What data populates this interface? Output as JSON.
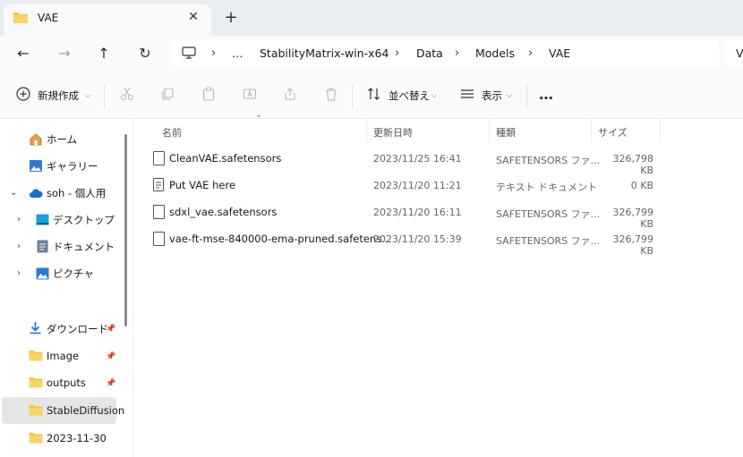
{
  "tab": {
    "title": "VAE",
    "close": "✕",
    "new_tab": "+"
  },
  "nav": {
    "back": "←",
    "forward": "→",
    "up": "↑",
    "refresh": "↻",
    "more": "…"
  },
  "breadcrumb": [
    "StabilityMatrix-win-x64",
    "Data",
    "Models",
    "VAE"
  ],
  "breadcrumb_sep": "›",
  "search_partial": "V",
  "toolbar": {
    "new_label": "新規作成",
    "sort_label": "並べ替え",
    "view_label": "表示",
    "more_label": "…"
  },
  "sidebar": {
    "items": [
      {
        "label": "ホーム",
        "icon": "home-icon"
      },
      {
        "label": "ギャラリー",
        "icon": "gallery-icon"
      },
      {
        "label": "soh - 個人用",
        "icon": "cloud-icon"
      },
      {
        "label": "デスクトップ",
        "icon": "desktop-icon"
      },
      {
        "label": "ドキュメント",
        "icon": "document-icon"
      },
      {
        "label": "ピクチャ",
        "icon": "picture-icon"
      },
      {
        "label": "ダウンロード",
        "icon": "download-icon"
      },
      {
        "label": "Image",
        "icon": "folder-icon"
      },
      {
        "label": "outputs",
        "icon": "folder-icon"
      },
      {
        "label": "StableDiffusion",
        "icon": "folder-icon"
      },
      {
        "label": "2023-11-30",
        "icon": "folder-icon"
      }
    ]
  },
  "columns": {
    "name": "名前",
    "date": "更新日時",
    "type": "種類",
    "size": "サイズ"
  },
  "files": [
    {
      "name": "CleanVAE.safetensors",
      "date": "2023/11/25 16:41",
      "type": "SAFETENSORS ファ...",
      "size": "326,798 KB"
    },
    {
      "name": "Put VAE here",
      "date": "2023/11/20 11:21",
      "type": "テキスト ドキュメント",
      "size": "0 KB"
    },
    {
      "name": "sdxl_vae.safetensors",
      "date": "2023/11/20 16:11",
      "type": "SAFETENSORS ファ...",
      "size": "326,799 KB"
    },
    {
      "name": "vae-ft-mse-840000-ema-pruned.safetens...",
      "date": "2023/11/20 15:39",
      "type": "SAFETENSORS ファ...",
      "size": "326,799 KB"
    }
  ],
  "colors": {
    "accent": "#005fb8",
    "folder": "#f4c542",
    "selected": "#e5e5e5"
  }
}
